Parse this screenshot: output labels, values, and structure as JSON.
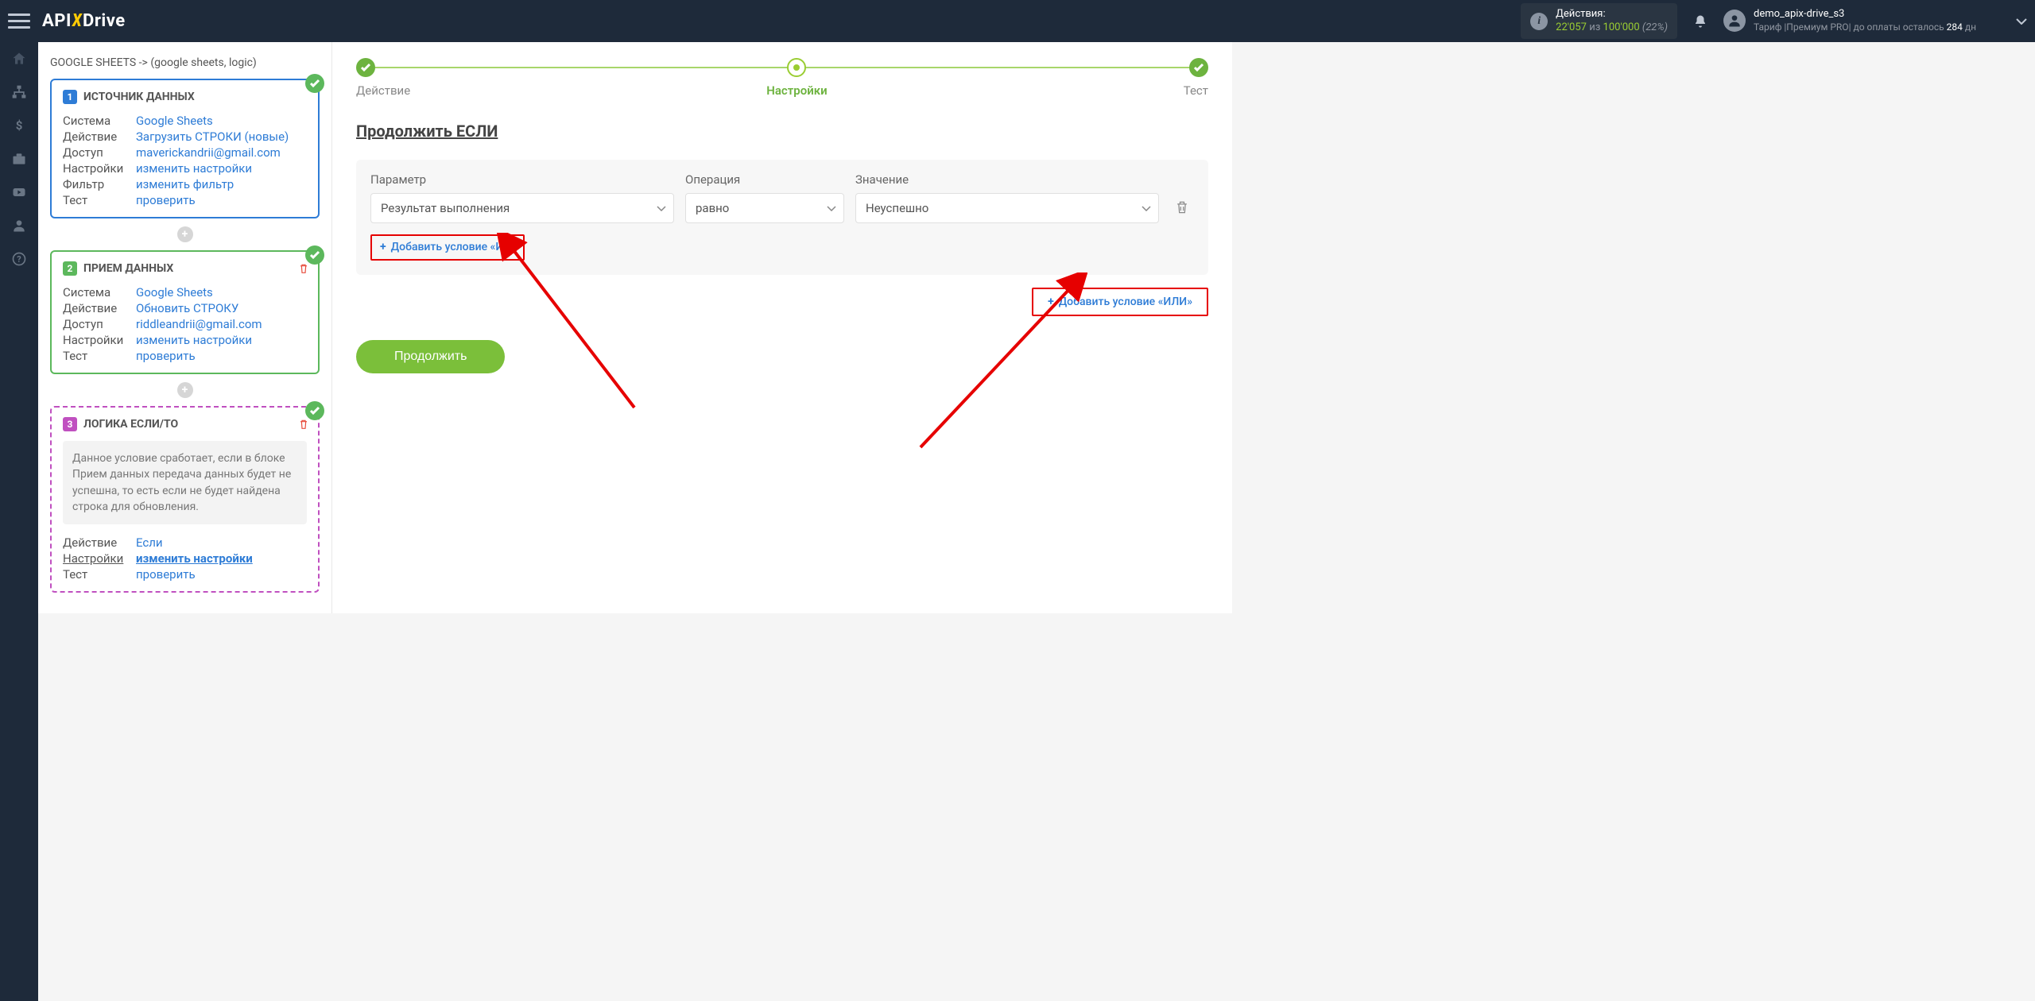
{
  "logo": {
    "part1": "API",
    "part2": "X",
    "part3": "Drive"
  },
  "header": {
    "actions_label": "Действия:",
    "actions_used": "22'057",
    "actions_of": "из",
    "actions_total": "100'000",
    "actions_pct": "(22%)",
    "user_name": "demo_apix-drive_s3",
    "tariff_line_prefix": "Тариф |Премиум PRO| до оплаты осталось ",
    "tariff_days": "284",
    "tariff_suffix": " дн"
  },
  "breadcrumb": "GOOGLE SHEETS -> (google sheets, logic)",
  "card1": {
    "num": "1",
    "title": "ИСТОЧНИК ДАННЫХ",
    "rows": {
      "system_lbl": "Система",
      "system_val": "Google Sheets",
      "action_lbl": "Действие",
      "action_val": "Загрузить СТРОКИ (новые)",
      "access_lbl": "Доступ",
      "access_val": "maverickandrii@gmail.com",
      "settings_lbl": "Настройки",
      "settings_val": "изменить настройки",
      "filter_lbl": "Фильтр",
      "filter_val": "изменить фильтр",
      "test_lbl": "Тест",
      "test_val": "проверить"
    }
  },
  "card2": {
    "num": "2",
    "title": "ПРИЕМ ДАННЫХ",
    "rows": {
      "system_lbl": "Система",
      "system_val": "Google Sheets",
      "action_lbl": "Действие",
      "action_val": "Обновить СТРОКУ",
      "access_lbl": "Доступ",
      "access_val": "riddleandrii@gmail.com",
      "settings_lbl": "Настройки",
      "settings_val": "изменить настройки",
      "test_lbl": "Тест",
      "test_val": "проверить"
    }
  },
  "card3": {
    "num": "3",
    "title": "ЛОГИКА ЕСЛИ/ТО",
    "desc": "Данное условие сработает, если в блоке Прием данных передача данных будет не успешна, то есть если не будет найдена строка для обновления.",
    "rows": {
      "action_lbl": "Действие",
      "action_val": "Если",
      "settings_lbl": "Настройки",
      "settings_val": "изменить настройки",
      "test_lbl": "Тест",
      "test_val": "проверить"
    }
  },
  "wizard": {
    "step1": "Действие",
    "step2": "Настройки",
    "step3": "Тест"
  },
  "main": {
    "section_title": "Продолжить ЕСЛИ",
    "col_param": "Параметр",
    "col_op": "Операция",
    "col_val": "Значение",
    "select_param": "Результат выполнения",
    "select_op": "равно",
    "select_val": "Неуспешно",
    "add_and": "Добавить условие «И»",
    "add_or": "Добавить условие «ИЛИ»",
    "continue": "Продолжить"
  }
}
